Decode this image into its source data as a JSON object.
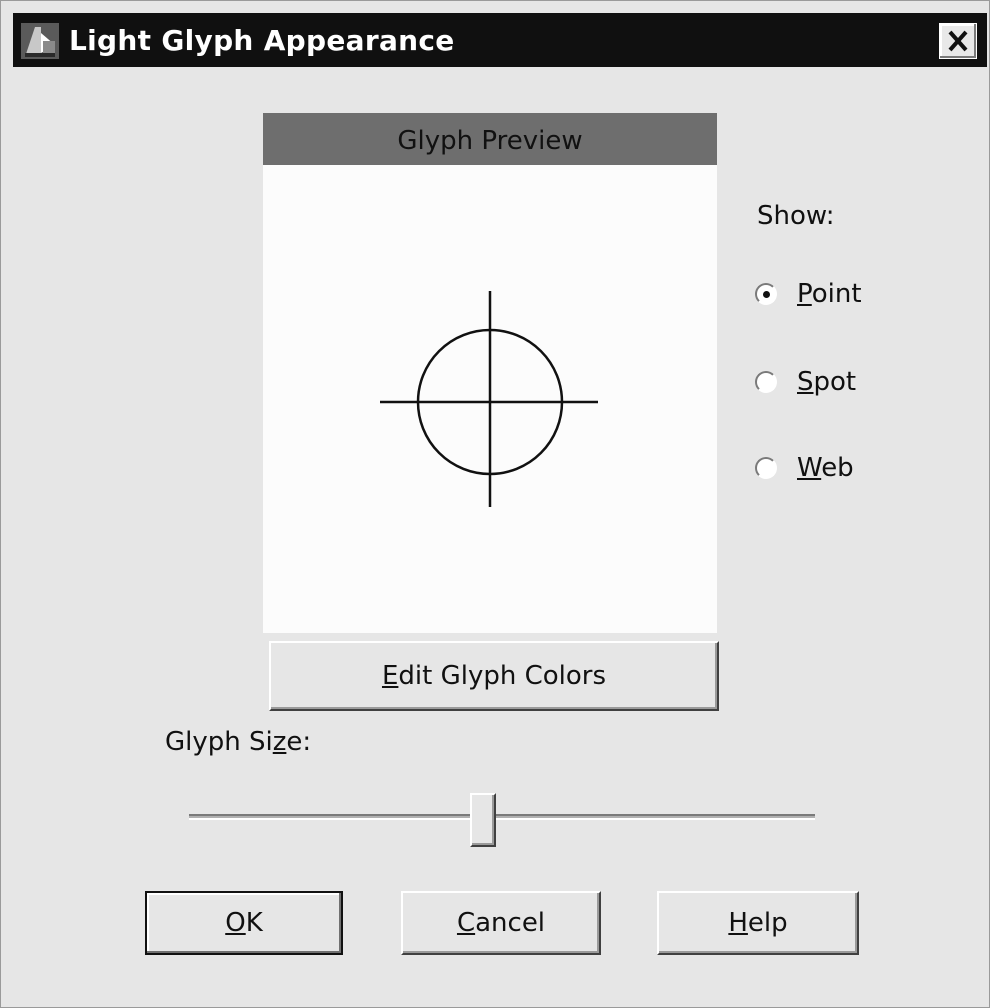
{
  "window": {
    "title": "Light Glyph Appearance",
    "app_icon": "glyph-app-icon",
    "close_icon": "close-icon"
  },
  "preview": {
    "header": "Glyph Preview",
    "glyph_icon": "crosshair-circle-glyph"
  },
  "buttons": {
    "edit_colors": {
      "pre": "",
      "mnemonic": "E",
      "post": "dit Glyph Colors"
    },
    "ok": {
      "pre": "",
      "mnemonic": "O",
      "post": "K"
    },
    "cancel": {
      "pre": "",
      "mnemonic": "C",
      "post": "ancel"
    },
    "help": {
      "pre": "",
      "mnemonic": "H",
      "post": "elp"
    }
  },
  "show": {
    "label": "Show:",
    "selected": "Point",
    "options": [
      {
        "pre": "",
        "mnemonic": "P",
        "post": "oint"
      },
      {
        "pre": "",
        "mnemonic": "S",
        "post": "pot"
      },
      {
        "pre": "",
        "mnemonic": "W",
        "post": "eb"
      }
    ]
  },
  "glyph_size": {
    "label": {
      "pre": "Glyph Si",
      "mnemonic": "z",
      "post": "e:"
    },
    "value_fraction": 0.47
  },
  "colors": {
    "title_bar": "#101010",
    "preview_header": "#6e6e6e",
    "dialog_bg": "#e6e6e6"
  }
}
